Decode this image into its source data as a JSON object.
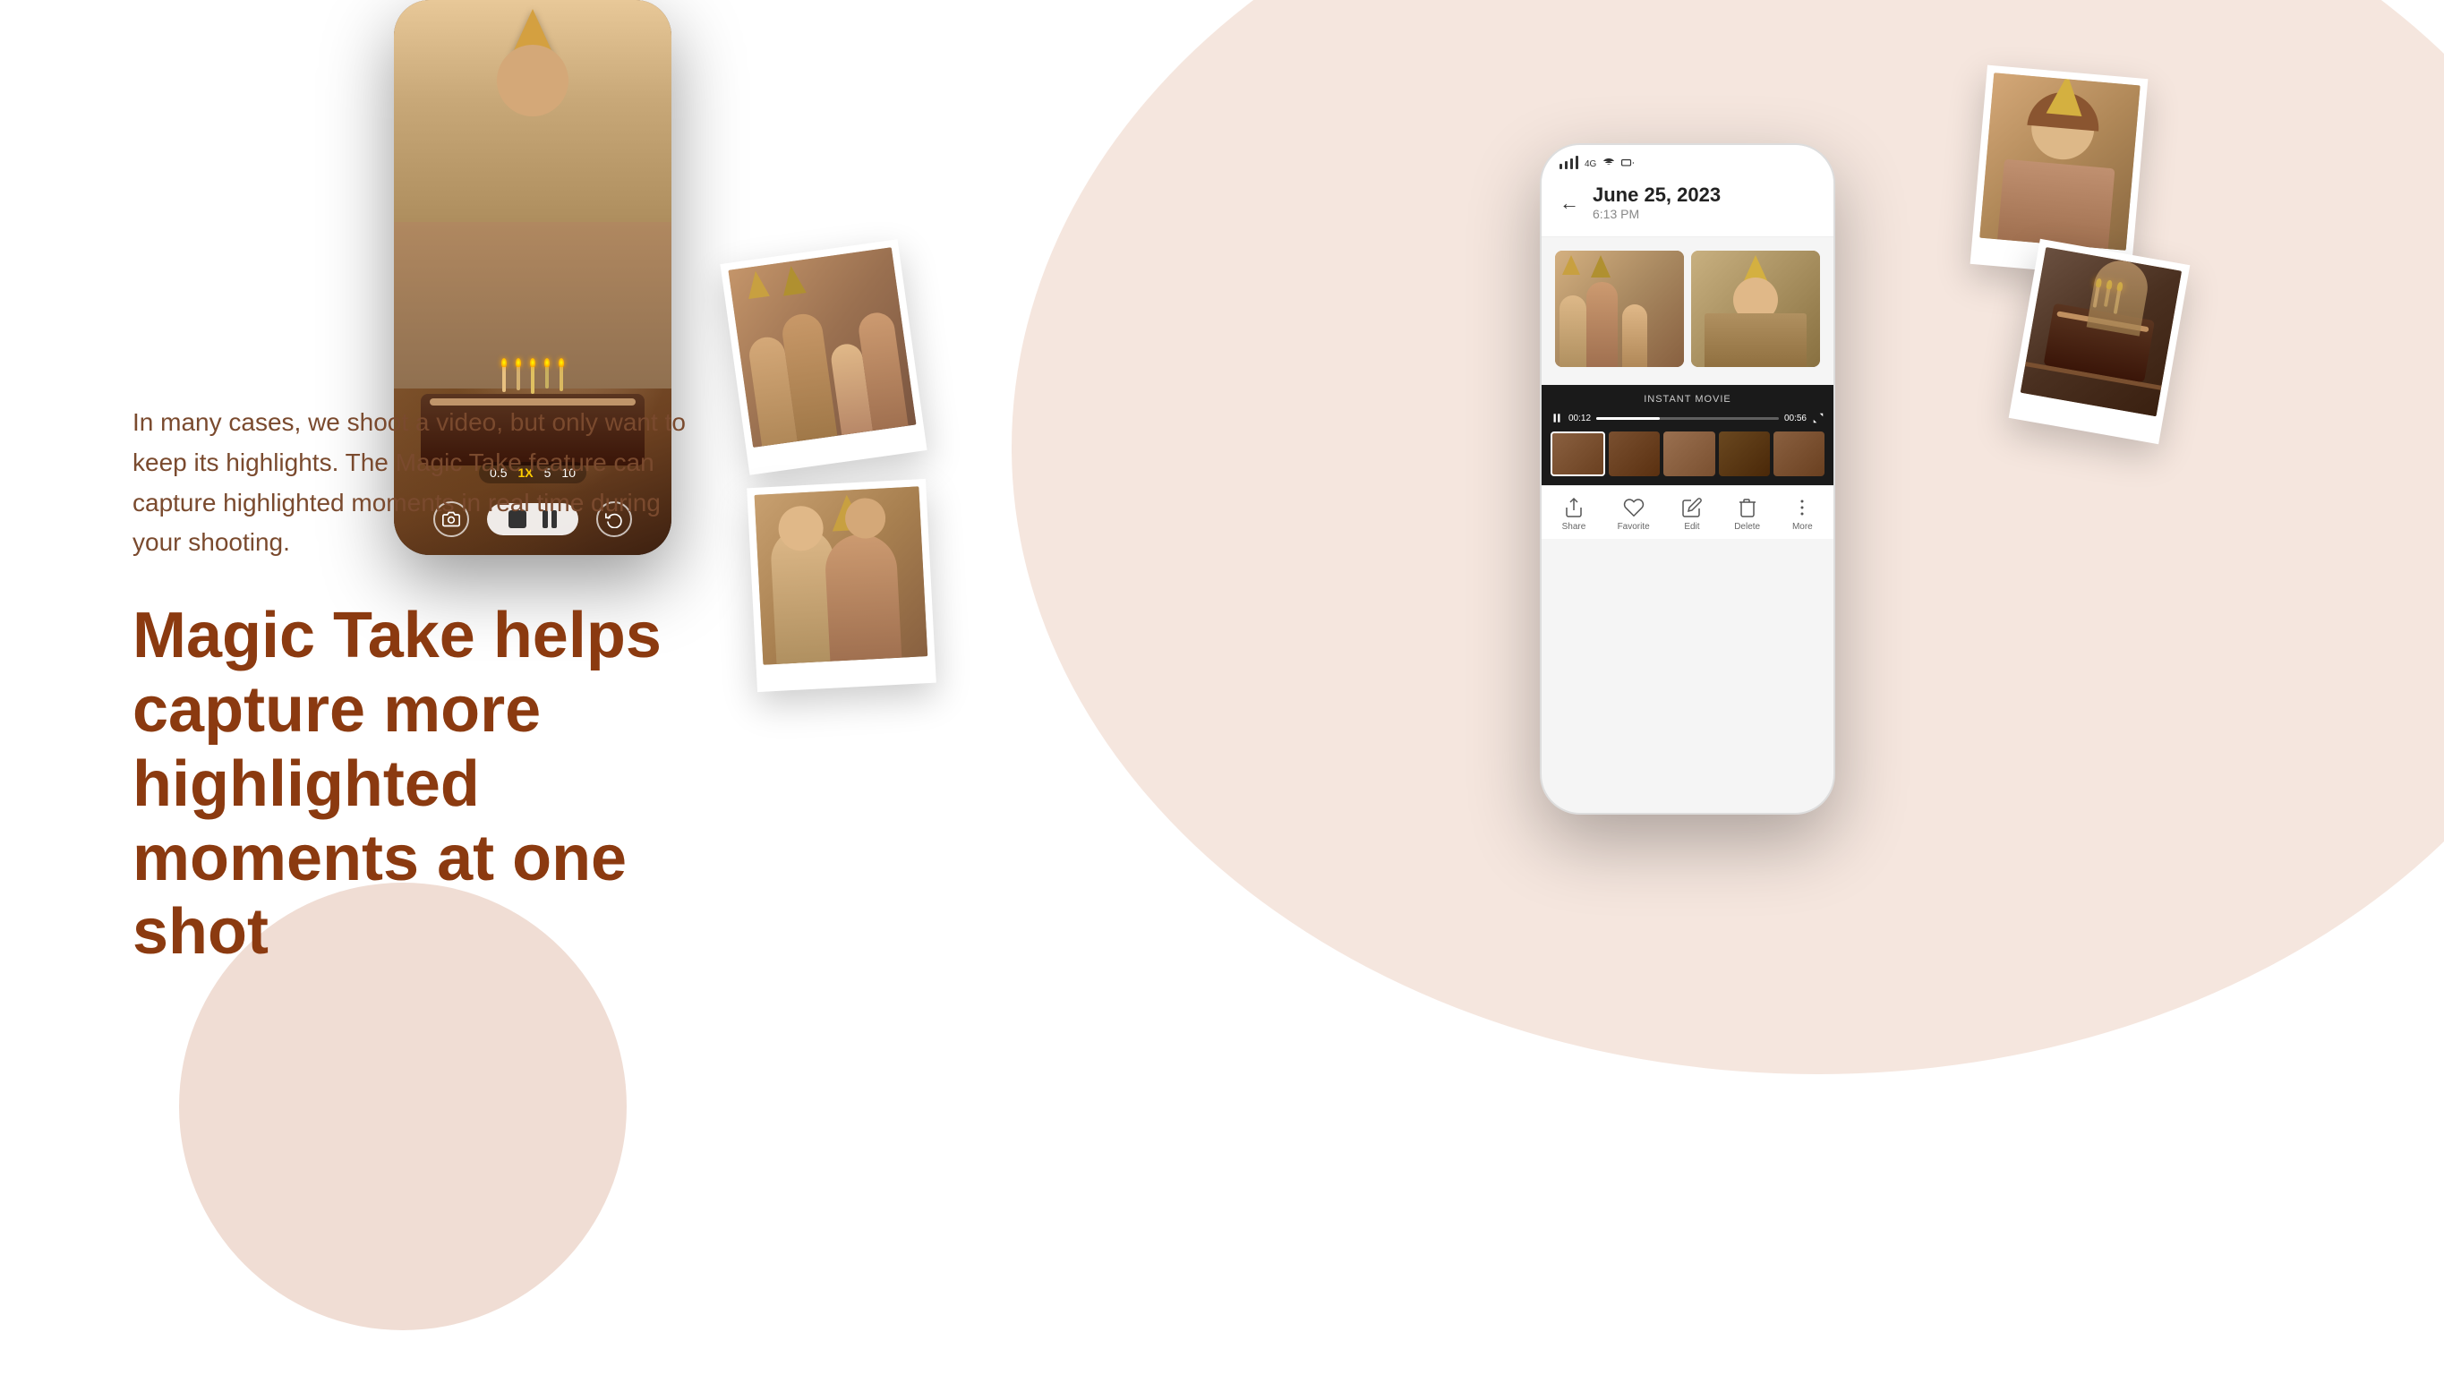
{
  "background": {
    "main_circle_color": "#f5e6de",
    "small_circle_color": "#f0ddd4"
  },
  "text": {
    "description": "In many cases, we shoot a video, but only want to keep its highlights. The Magic Take feature can capture highlighted moments in real time during your shooting.",
    "headline_line1": "Magic Take helps capture more",
    "headline_line2": "highlighted moments at one shot"
  },
  "phone_camera": {
    "zoom_options": [
      "0.5",
      "1X",
      "5",
      "10"
    ],
    "zoom_active": "1X"
  },
  "phone_gallery": {
    "status": {
      "signal": "📶",
      "wifi": "📡",
      "battery": "🔋",
      "time": ""
    },
    "header": {
      "date": "June 25, 2023",
      "time": "6:13 PM"
    },
    "video_section": {
      "label": "INSTANT MOVIE",
      "time_current": "00:12",
      "time_total": "00:56"
    },
    "action_bar": {
      "items": [
        {
          "icon": "share",
          "label": "Share"
        },
        {
          "icon": "heart",
          "label": "Favorite"
        },
        {
          "icon": "edit",
          "label": "Edit"
        },
        {
          "icon": "trash",
          "label": "Delete"
        },
        {
          "icon": "more",
          "label": "More"
        }
      ]
    }
  },
  "polaroids": {
    "p1": "family group photo",
    "p2": "girl with party hat",
    "p3": "birthday cake",
    "p4": "couple smiling"
  }
}
